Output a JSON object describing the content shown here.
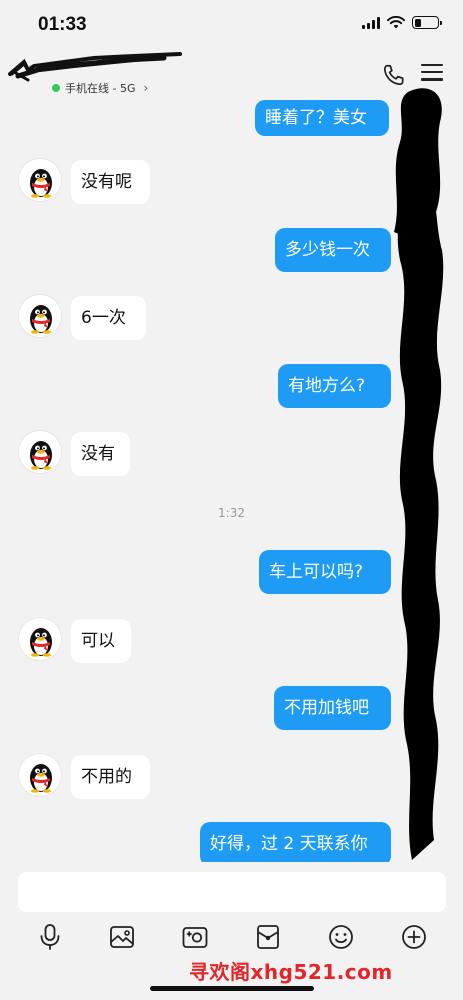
{
  "status_bar": {
    "time": "01:33",
    "signal_bars": 4,
    "wifi": "wifi-icon",
    "battery_level": 0.3
  },
  "header": {
    "presence_text": "手机在线 - 5G",
    "presence_color": "#34c759",
    "call_icon": "phone-icon",
    "menu_icon": "menu-icon"
  },
  "colors": {
    "outgoing_bubble": "#1e9cf5",
    "incoming_bubble": "#ffffff",
    "background": "#f2f2f2"
  },
  "messages": [
    {
      "side": "out",
      "text": "睡着了？美女"
    },
    {
      "side": "in",
      "text": "没有呢"
    },
    {
      "side": "out",
      "text": "多少钱一次"
    },
    {
      "side": "in",
      "text": "6一次"
    },
    {
      "side": "out",
      "text": "有地方么?"
    },
    {
      "side": "in",
      "text": "没有"
    },
    {
      "side": "out",
      "text": "车上可以吗?"
    },
    {
      "side": "in",
      "text": "可以"
    },
    {
      "side": "out",
      "text": "不用加钱吧"
    },
    {
      "side": "in",
      "text": "不用的"
    },
    {
      "side": "out",
      "text": "好得，过 2 天联系你"
    }
  ],
  "timestamp": "1:32",
  "composer": {
    "value": "",
    "placeholder": ""
  },
  "toolbar": [
    "microphone-icon",
    "image-icon",
    "camera-icon",
    "red-packet-icon",
    "emoji-icon",
    "plus-icon"
  ],
  "watermark": "寻欢阁xhg521.com"
}
